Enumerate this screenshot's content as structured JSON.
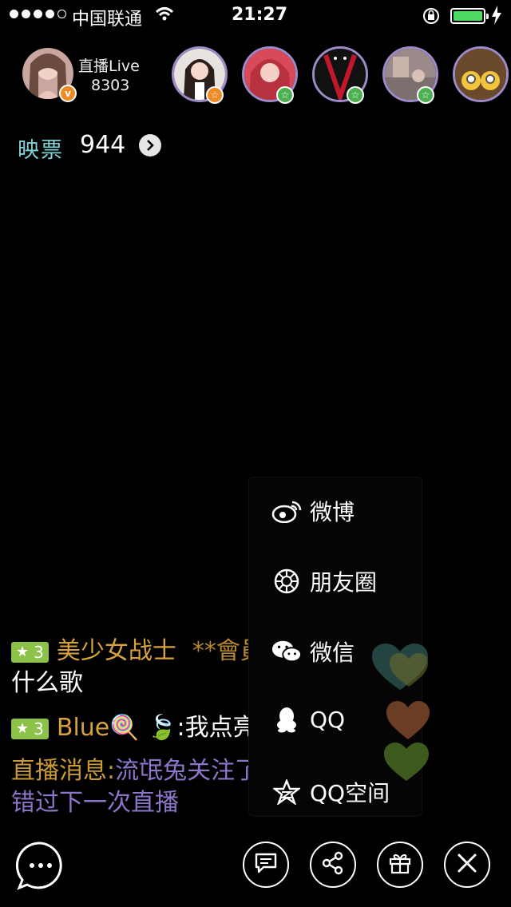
{
  "status_bar": {
    "carrier": "中国联通",
    "time": "21:27",
    "battery_color": "#4cd964"
  },
  "host": {
    "name": "直播Live",
    "count": "8303",
    "badge": "v",
    "badge_color": "#f08a24"
  },
  "viewers": [
    {
      "name": "viewer-1",
      "badge_color": "#f08a24"
    },
    {
      "name": "viewer-2",
      "badge_color": "#4caf50"
    },
    {
      "name": "viewer-3",
      "badge_color": "#4caf50"
    },
    {
      "name": "viewer-4",
      "badge_color": "#4caf50"
    },
    {
      "name": "viewer-5",
      "badge_color": ""
    }
  ],
  "ticket": {
    "label": "映票",
    "value": "944"
  },
  "share_menu": {
    "items": [
      {
        "label": "微博",
        "icon": "weibo-icon"
      },
      {
        "label": "朋友圈",
        "icon": "moments-icon"
      },
      {
        "label": "微信",
        "icon": "wechat-icon"
      },
      {
        "label": "QQ",
        "icon": "qq-icon"
      },
      {
        "label": "QQ空间",
        "icon": "qzone-icon"
      }
    ]
  },
  "chat": {
    "messages": [
      {
        "level": "3",
        "user": "美少女战士",
        "extra": "**會員寶寶",
        "text": "什么歌"
      },
      {
        "level": "3",
        "user": "Blue🍭 🍃",
        "text": ":我点亮了"
      }
    ],
    "system_prefix": "直播消息:",
    "system_text_line1": "流氓兔关注了主播，不",
    "system_text_line2": "错过下一次直播"
  },
  "bottom_bar": {
    "buttons": [
      "chat-bubble-icon",
      "message-icon",
      "share-icon",
      "gift-icon",
      "close-icon"
    ]
  }
}
